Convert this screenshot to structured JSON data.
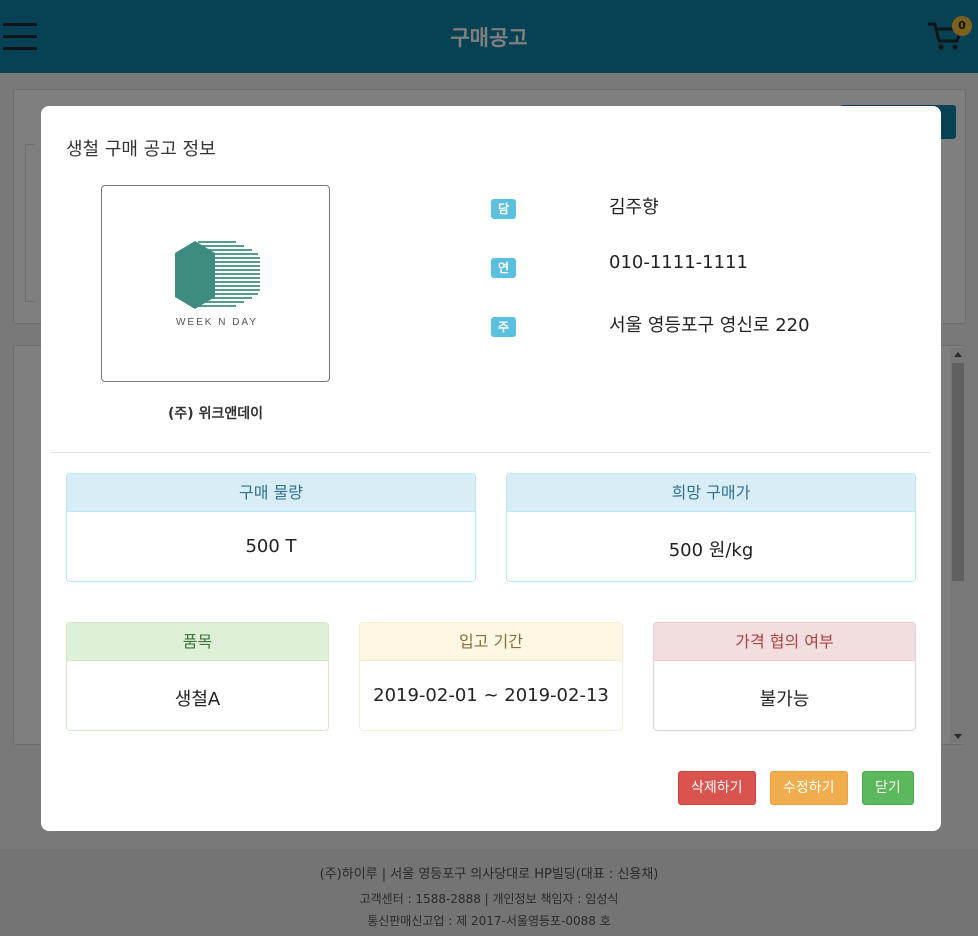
{
  "header": {
    "title": "구매공고",
    "cart_count": "0"
  },
  "footer": {
    "line1": "(주)하이루 | 서울 영등포구 의사당대로 HP빌딩(대표 : 신용채)",
    "line2": "고객센터 : 1588-2888 | 개인정보 책임자 : 임성식",
    "line3": "통신판매신고업 : 제 2017-서울영등포-0088 호"
  },
  "modal": {
    "title": "생철 구매 공고 정보",
    "company_name": "(주) 위크앤데이",
    "logo_text": "WEEK N DAY",
    "info": {
      "manager_label": "담당자",
      "manager_value": "김주향",
      "contact_label": "연락처",
      "contact_value": "010-1111-1111",
      "address_label": "주소",
      "address_value": "서울 영등포구 영신로 220"
    },
    "cards": {
      "quantity_title": "구매 물량",
      "quantity_value": "500 T",
      "price_title": "희망 구매가",
      "price_value": "500 원/kg",
      "item_title": "품목",
      "item_value": "생철A",
      "period_title": "입고 기간",
      "period_value": "2019-02-01 ~ 2019-02-13",
      "negotiation_title": "가격 협의 여부",
      "negotiation_value": "불가능"
    },
    "buttons": {
      "delete": "삭제하기",
      "edit": "수정하기",
      "close": "닫기"
    }
  },
  "colors": {
    "header_bg": "#0d82a8",
    "label_bg": "#5bc0de",
    "danger": "#d9534f",
    "warning": "#f0ad4e",
    "success": "#5cb85c"
  },
  "icons": [
    "hamburger-menu-icon",
    "cart-icon"
  ]
}
